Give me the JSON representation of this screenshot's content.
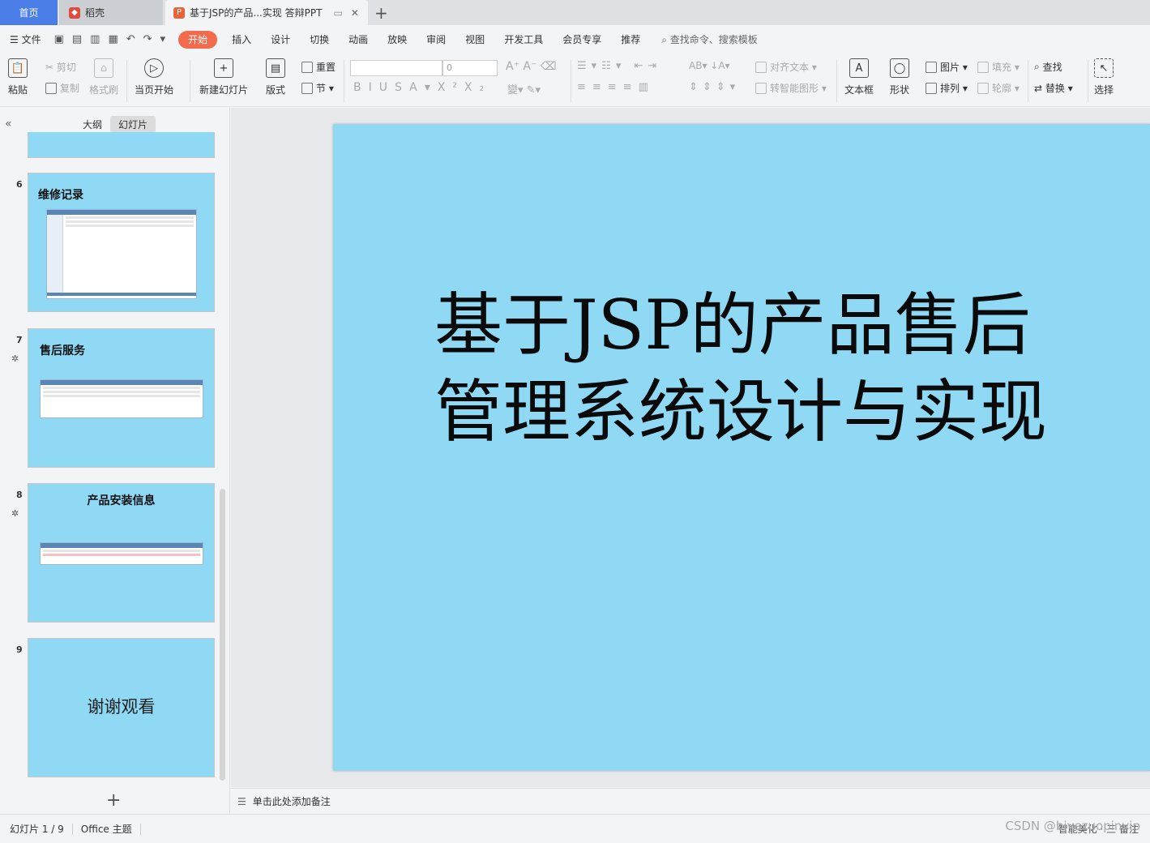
{
  "tabs": {
    "home": "首页",
    "daoke": "稻壳",
    "doc": "基于JSP的产品...实现 答辩PPT"
  },
  "menu": {
    "file": "文件",
    "items": [
      "开始",
      "插入",
      "设计",
      "切换",
      "动画",
      "放映",
      "审阅",
      "视图",
      "开发工具",
      "会员专享",
      "推荐"
    ],
    "active": "开始",
    "search": "查找命令、搜索模板"
  },
  "ribbon": {
    "paste": "粘贴",
    "cut": "剪切",
    "copy": "复制",
    "format_painter": "格式刷",
    "start_from_current": "当页开始",
    "new_slide": "新建幻灯片",
    "layout": "版式",
    "reset": "重置",
    "section": "节",
    "font_size": "0",
    "align_text": "对齐文本",
    "smart_shape": "转智能图形",
    "textbox": "文本框",
    "shape": "形状",
    "picture": "图片",
    "arrange": "排列",
    "fill": "填充",
    "outline": "轮廓",
    "find": "查找",
    "replace": "替换",
    "select": "选择"
  },
  "sidebar": {
    "outline_tab": "大纲",
    "slides_tab": "幻灯片",
    "thumbs": [
      {
        "num": "6",
        "title": "维修记录"
      },
      {
        "num": "7",
        "title": "售后服务"
      },
      {
        "num": "8",
        "title": "产品安装信息"
      },
      {
        "num": "9",
        "title": "谢谢观看"
      }
    ]
  },
  "slide": {
    "title": "基于JSP的产品售后管理系统设计与实现"
  },
  "notes": {
    "placeholder": "单击此处添加备注"
  },
  "status": {
    "slide_counter": "幻灯片 1 / 9",
    "theme": "Office 主题",
    "right_text": "智能美化 · 三 备注",
    "watermark": "CSDN @biyezuopinvip"
  },
  "colors": {
    "slide_bg": "#8fd9f5",
    "accent": "#f26b4c",
    "home_tab": "#4a7ee6"
  }
}
